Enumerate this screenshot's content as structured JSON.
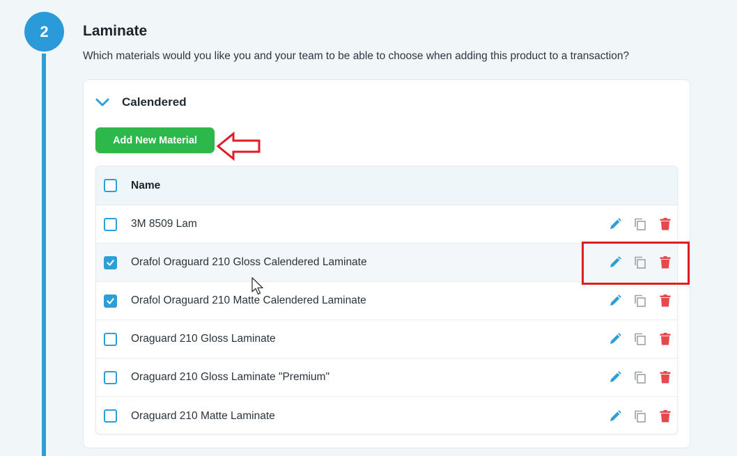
{
  "step": {
    "number": "2"
  },
  "section": {
    "title": "Laminate",
    "subtitle": "Which materials would you like you and your team to be able to choose when adding this product to a transaction?"
  },
  "group": {
    "title": "Calendered",
    "add_button_label": "Add New Material"
  },
  "table": {
    "header": {
      "name": "Name"
    },
    "rows": [
      {
        "name": "3M 8509 Lam",
        "checked": false
      },
      {
        "name": "Orafol Oraguard 210 Gloss Calendered Laminate",
        "checked": true
      },
      {
        "name": "Orafol Oraguard 210 Matte Calendered Laminate",
        "checked": true
      },
      {
        "name": "Oraguard 210 Gloss Laminate",
        "checked": false
      },
      {
        "name": "Oraguard 210 Gloss Laminate \"Premium\"",
        "checked": false
      },
      {
        "name": "Oraguard 210 Matte Laminate",
        "checked": false
      }
    ]
  },
  "icons": {
    "edit": "pencil-icon",
    "duplicate": "copy-icon",
    "delete": "trash-icon",
    "expand": "chevron-down-icon"
  },
  "colors": {
    "accent": "#2e9fd6",
    "add_button": "#2db84c",
    "delete": "#e5484d",
    "annotation": "#e01b24"
  }
}
